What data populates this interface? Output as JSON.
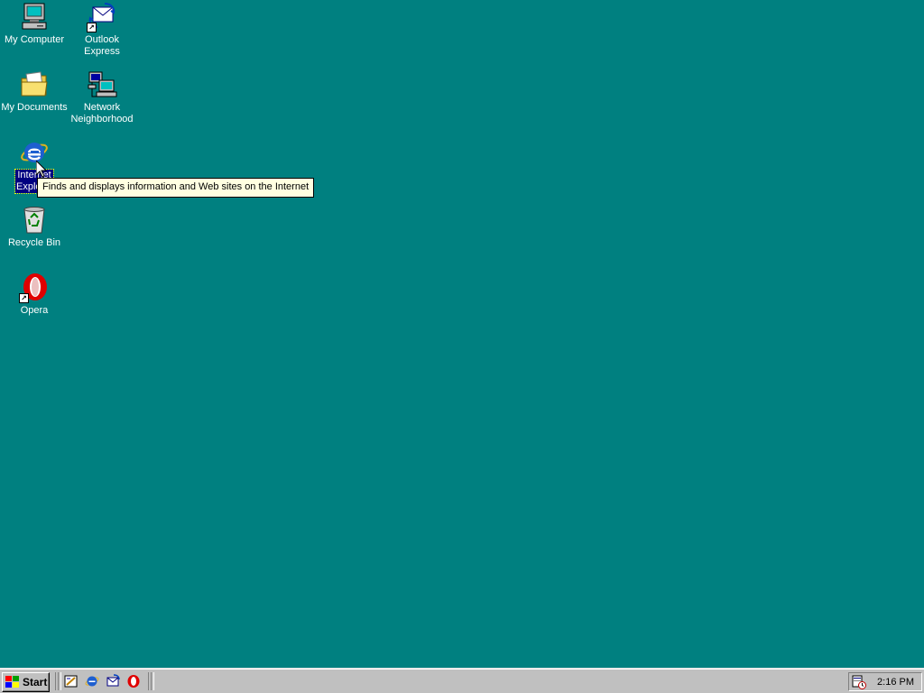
{
  "desktop": {
    "background": "#008080",
    "icons": [
      {
        "label": "My Computer",
        "icon": "my-computer-icon"
      },
      {
        "label": "Outlook Express",
        "icon": "outlook-express-icon"
      },
      {
        "label": "My Documents",
        "icon": "my-documents-icon"
      },
      {
        "label": "Network Neighborhood",
        "icon": "network-neighborhood-icon"
      },
      {
        "label": "Internet Explorer",
        "icon": "internet-explorer-icon",
        "selected": true
      },
      {
        "label": "Recycle Bin",
        "icon": "recycle-bin-icon"
      },
      {
        "label": "Opera",
        "icon": "opera-icon"
      }
    ]
  },
  "tooltip": {
    "text": "Finds and displays information and Web sites on the Internet"
  },
  "taskbar": {
    "start_label": "Start",
    "quick_launch": [
      {
        "icon": "show-desktop-icon"
      },
      {
        "icon": "internet-explorer-icon"
      },
      {
        "icon": "outlook-express-icon"
      },
      {
        "icon": "opera-icon"
      }
    ],
    "tray": {
      "icon": "scheduler-icon",
      "clock": "2:16 PM"
    }
  }
}
